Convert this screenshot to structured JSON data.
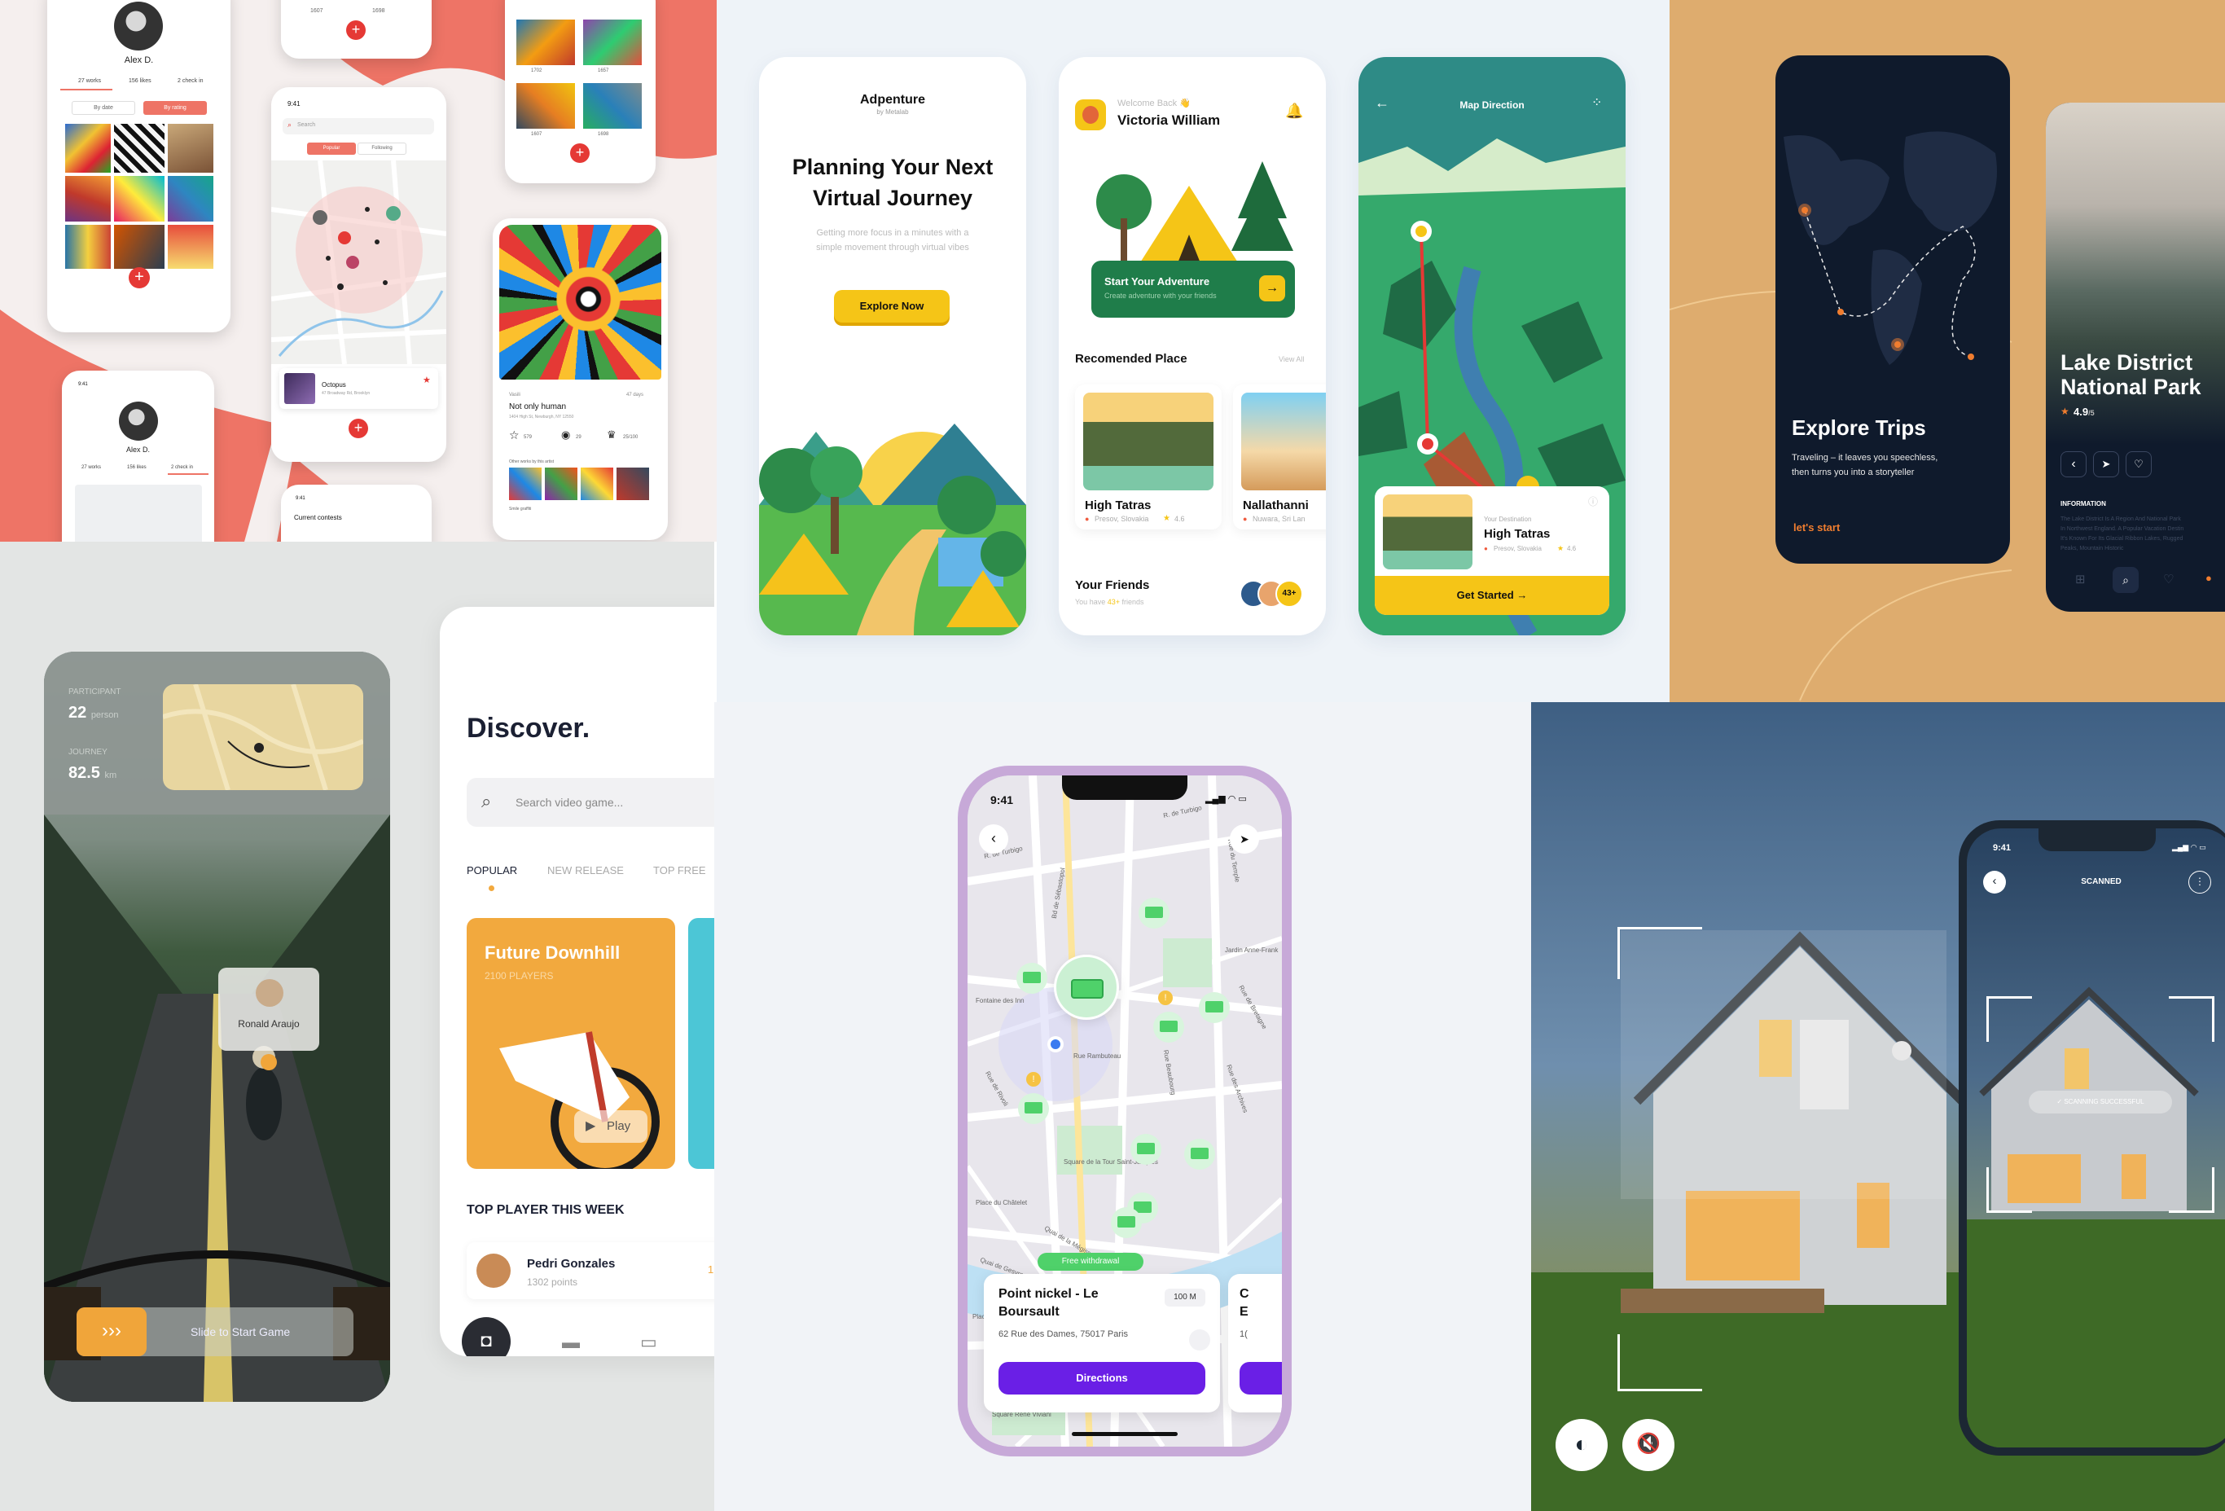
{
  "colors": {
    "coral": "#ee7466",
    "adpenture_bg": "#eef3f8",
    "adpenture_yellow": "#f5c517",
    "map_teal": "#2e8b86",
    "explore_tan": "#deac6e",
    "explore_navy": "#0f1a2c",
    "explore_orange": "#f07d2f",
    "discover_orange": "#f2a93e",
    "atm_purple": "#6a1fe6",
    "cash_green": "#4fd16a",
    "house_sky": "#5a7fa3"
  },
  "art": {
    "profile1": {
      "name": "Alex D.",
      "works": "27 works",
      "likes": "156 likes",
      "checkin": "2 check in",
      "tab_date": "By date",
      "tab_rating": "By rating"
    },
    "feed_top": {
      "likes_a": "1607",
      "likes_b": "1698"
    },
    "map_search": {
      "time": "9:41",
      "placeholder": "Search",
      "tab_popular": "Popular",
      "tab_following": "Following",
      "card_title": "Octopus",
      "card_sub": "47 Broadway Rd, Brooklyn"
    },
    "grid_feed": {
      "a": "1702",
      "b": "1657",
      "c": "1607",
      "d": "1698"
    },
    "profile2": {
      "time": "9:41",
      "name": "Alex D.",
      "works": "27 works",
      "likes": "156 likes",
      "checkin": "2 check in"
    },
    "contests": {
      "time": "9:41",
      "label": "Current contests"
    },
    "artwork": {
      "title": "Not only human",
      "days": "47 days",
      "author": "Vasili",
      "address": "1404 High St, Newburgh, NY 12550",
      "stat_a": "579",
      "stat_b": "29",
      "stat_c": "25/100",
      "other_label": "Other works by this artist",
      "caption": "Smile graffiti"
    }
  },
  "adpenture": {
    "welcome": {
      "logo": "Adpenture",
      "logo_sub": "by Metalab",
      "title_line1": "Planning Your Next",
      "title_line2": "Virtual Journey",
      "subtitle_line1": "Getting more focus in a minutes with a",
      "subtitle_line2": "simple movement through virtual vibes",
      "button": "Explore Now"
    },
    "home": {
      "welcome": "Welcome Back 👋",
      "name": "Victoria William",
      "cta_title": "Start Your Adventure",
      "cta_sub": "Create adventure with your friends",
      "section": "Recomended Place",
      "view_all": "View All",
      "place1_name": "High Tatras",
      "place1_loc": "Presov, Slovakia",
      "place1_rating": "4.6",
      "place2_name": "Nallathanni",
      "place2_loc": "Nuwara, Sri Lan",
      "friends_title": "Your Friends",
      "friends_sub_a": "You have ",
      "friends_count": "43+",
      "friends_sub_b": " friends",
      "friends_badge": "43+"
    },
    "map": {
      "title": "Map Direction",
      "dest_label": "Your Destination",
      "dest_name": "High Tatras",
      "dest_loc": "Presov, Slovakia",
      "dest_rating": "4.6",
      "button": "Get Started"
    }
  },
  "explore": {
    "title": "Explore Trips",
    "sub_line1": "Traveling – it leaves you speechless,",
    "sub_line2": "then turns you into a storyteller",
    "cta": "let's start",
    "park_line1": "Lake District",
    "park_line2": "National Park",
    "park_rating": "4.9",
    "park_rating_max": "/5",
    "info_label": "INFORMATION",
    "info_text_line1": "The Lake District Is A Region And National Park",
    "info_text_line2": "In Northwest England. A Popular Vacation Destin",
    "info_text_line3": "It's Known For Its Glacial Ribbon Lakes, Rugged",
    "info_text_line4": "Peaks, Mountain Historic"
  },
  "cycling": {
    "participant_label": "PARTICIPANT",
    "participant_value": "22",
    "participant_unit": "person",
    "journey_label": "JOURNEY",
    "journey_value": "82.5",
    "journey_unit": "km",
    "rider": "Ronald Araujo",
    "slide": "Slide to Start Game",
    "arrows": "›››"
  },
  "discover": {
    "title": "Discover.",
    "search_placeholder": "Search video game...",
    "tabs": [
      "POPULAR",
      "NEW RELEASE",
      "TOP FREE"
    ],
    "card_title": "Future Downhill",
    "card_sub": "2100 PLAYERS",
    "play": "Play",
    "top_title": "TOP PLAYER THIS WEEK",
    "player_name": "Pedri Gonzales",
    "player_points": "1302 points",
    "player_rank": "1"
  },
  "atm": {
    "time": "9:41",
    "streets": [
      "R. de Turbigo",
      "R. de Turbigo",
      "Fontaine des Inn",
      "Square de la Tour Saint-Jacques",
      "Place du Châtelet",
      "Quai de la Mégisserie",
      "Rue de Rivoli",
      "Bd de Sébastopol",
      "Rue Rambuteau",
      "Rue Beaubourg",
      "Jardin Anne-Frank",
      "Rue du Temple",
      "Rue de Bretagne",
      "Quai de Gesvres",
      "Place Louis Lépine",
      "Square René Viviani",
      "Rue des Archives"
    ],
    "badge": "Free withdrawal",
    "place_line1": "Point nickel - Le",
    "place_line2": "Boursault",
    "distance": "100 M",
    "address": "62 Rue des Dames, 75017 Paris",
    "button": "Directions",
    "peek_a": "C",
    "peek_b": "E",
    "peek_c": "1("
  },
  "house": {
    "time": "9:41",
    "header": "SCANNED",
    "toast": "SCANNING SUCCESSFUL"
  }
}
